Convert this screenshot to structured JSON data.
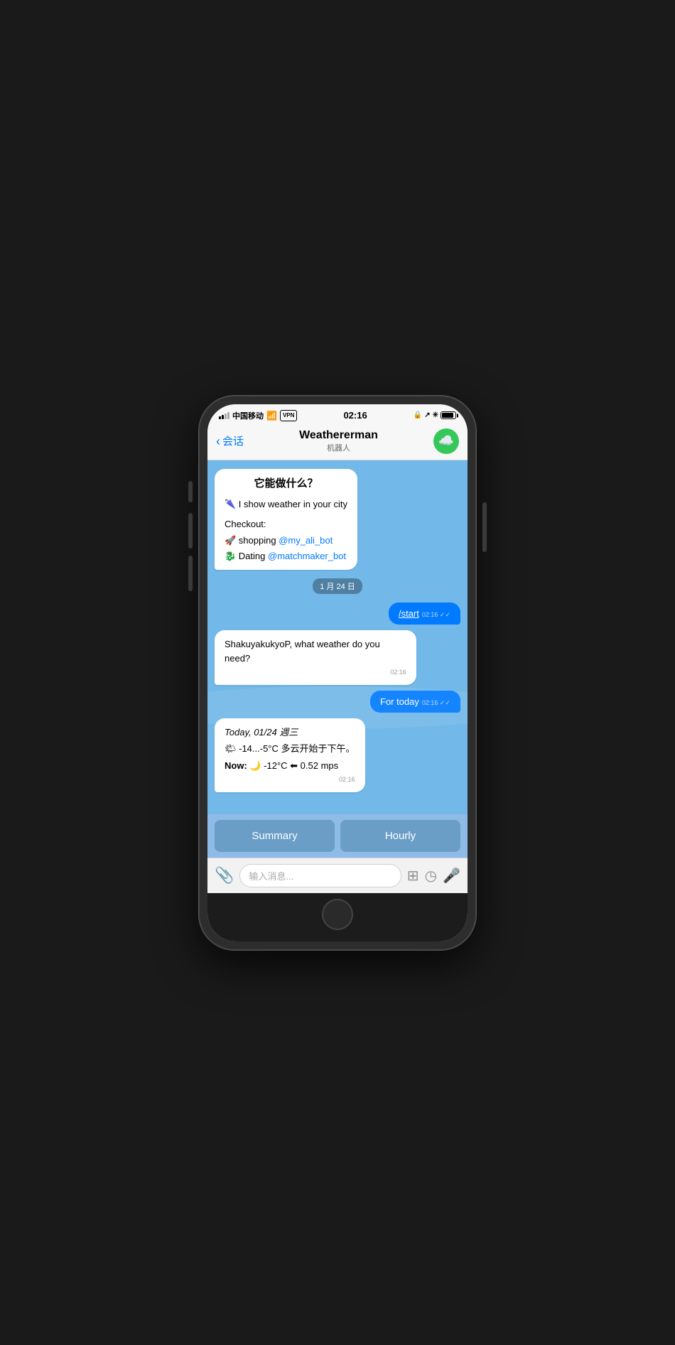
{
  "status": {
    "carrier": "中国移动",
    "wifi": "WiFi",
    "vpn": "VPN",
    "time": "02:16",
    "battery_level": "90%"
  },
  "nav": {
    "back_label": "会话",
    "title": "Weathererman",
    "subtitle": "机器人",
    "avatar_icon": "☁️"
  },
  "chat": {
    "date_badge": "1 月 24 日",
    "bot_intro": {
      "heading": "它能做什么？",
      "line1": "🌂 I show weather in your city",
      "checkout": "Checkout:",
      "shopping": "🚀 shopping ",
      "shopping_link": "@my_ali_bot",
      "dating": "🐉 Dating ",
      "dating_link": "@matchmaker_bot"
    },
    "msg_start": {
      "text": "/start",
      "time": "02:16",
      "read": true
    },
    "msg_bot_reply": {
      "text": "ShakuyakukyoP, what weather do you need?",
      "time": "02:16"
    },
    "msg_for_today": {
      "text": "For today",
      "time": "02:16",
      "read": true
    },
    "msg_weather": {
      "line1_italic": "Today, 01/24 週三",
      "line2": "🌤 -14...-5°C 多云开始于下午。",
      "line3_bold": "Now: ",
      "line3_rest": "🌙 -12°C ⬅ 0.52 mps",
      "time": "02:16"
    }
  },
  "keyboard_buttons": {
    "btn1": "Summary",
    "btn2": "Hourly"
  },
  "input": {
    "placeholder": "输入消息..."
  }
}
